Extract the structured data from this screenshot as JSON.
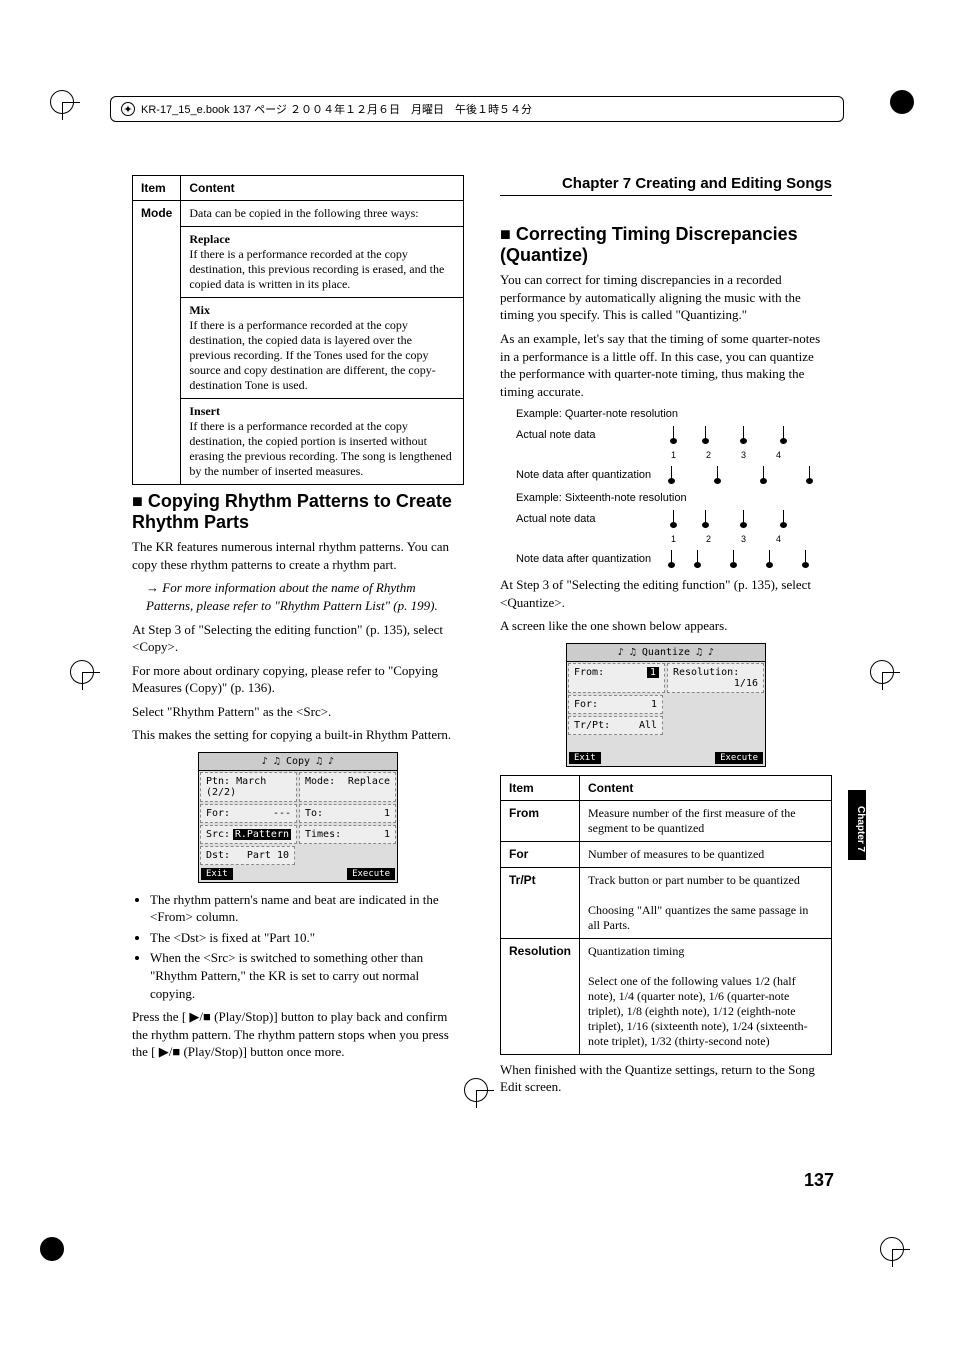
{
  "header": {
    "book_info": "KR-17_15_e.book  137 ページ  ２００４年１２月６日　月曜日　午後１時５４分"
  },
  "chapterTitle": "Chapter 7 Creating and Editing Songs",
  "sideTab": "Chapter 7",
  "pageNumber": "137",
  "left": {
    "table1": {
      "h1": "Item",
      "h2": "Content",
      "modeLabel": "Mode",
      "intro": "Data can be copied in the following three ways:",
      "replace": {
        "title": "Replace",
        "body": "If there is a performance recorded at the copy destination, this previous recording is erased, and the copied data is written in its place."
      },
      "mix": {
        "title": "Mix",
        "body": "If there is a performance recorded at the copy destination, the copied data is layered over the previous recording. If the Tones used for the copy source and copy destination are different, the copy-destination Tone is used."
      },
      "insert": {
        "title": "Insert",
        "body": "If there is a performance recorded at the copy destination, the copied portion is inserted without erasing the previous recording. The song is lengthened by the number of inserted measures."
      }
    },
    "h2": "Copying Rhythm Patterns to Create Rhythm Parts",
    "p1": "The KR features numerous internal rhythm patterns. You can copy these rhythm patterns to create a rhythm part.",
    "note1": "→ For more information about the name of Rhythm Patterns, please refer to \"Rhythm Pattern List\" (p. 199).",
    "p2": "At Step 3 of \"Selecting the editing function\" (p. 135), select <Copy>.",
    "p3": "For more about ordinary copying, please refer to \"Copying Measures (Copy)\" (p. 136).",
    "p4": "Select \"Rhythm Pattern\" as the <Src>.",
    "p5": "This makes the setting for copying a built-in Rhythm Pattern.",
    "screen": {
      "title": "Copy",
      "ptn_l": "Ptn:",
      "ptn_v": "March (2/2)",
      "mode_l": "Mode:",
      "mode_v": "Replace",
      "for_l": "For:",
      "for_v": "---",
      "to_l": "To:",
      "to_v": "1",
      "src_l": "Src:",
      "src_v": "R.Pattern",
      "times_l": "Times:",
      "times_v": "1",
      "dst_l": "Dst:",
      "dst_v": "Part 10",
      "exit": "Exit",
      "exec": "Execute"
    },
    "bul1": "The rhythm pattern's name and beat are indicated in the <From> column.",
    "bul2": "The <Dst> is fixed at \"Part 10.\"",
    "bul3": "When the <Src> is switched to something other than \"Rhythm Pattern,\" the KR is set to carry out normal copying.",
    "p6a": "Press the [ ",
    "p6b": " (Play/Stop)] button to play back and confirm the rhythm pattern. The rhythm pattern stops when you press the [ ",
    "p6c": " (Play/Stop)] button once more.",
    "playIcon": "▶/■"
  },
  "right": {
    "h2": "Correcting Timing Discrepancies (Quantize)",
    "p1": "You can correct for timing discrepancies in a recorded performance by automatically aligning the music with the timing you specify. This is called \"Quantizing.\"",
    "p2": "As an example, let's say that the timing of some quarter-notes in a performance is a little off. In this case, you can quantize the performance with quarter-note timing, thus making the timing accurate.",
    "diag": {
      "ex1": "Example: Quarter-note resolution",
      "lab1": "Actual note data",
      "lab2": "Note data after quantization",
      "ex2": "Example: Sixteenth-note resolution",
      "ticks": [
        "1",
        "2",
        "3",
        "4"
      ]
    },
    "p3": "At Step 3 of \"Selecting the editing function\" (p. 135), select <Quantize>.",
    "p4": "A screen like the one shown below appears.",
    "screen": {
      "title": "Quantize",
      "from_l": "From:",
      "from_v": "1",
      "res_l": "Resolution:",
      "res_v": "1/16",
      "for_l": "For:",
      "for_v": "1",
      "tr_l": "Tr/Pt:",
      "tr_v": "All",
      "exit": "Exit",
      "exec": "Execute"
    },
    "table": {
      "h1": "Item",
      "h2": "Content",
      "from_l": "From",
      "from_c": "Measure number of the first measure of the segment to be quantized",
      "for_l": "For",
      "for_c": "Number of measures to be quantized",
      "tr_l": "Tr/Pt",
      "tr_c1": "Track button or part number to be quantized",
      "tr_c2": "Choosing \"All\" quantizes the same passage in all Parts.",
      "res_l": "Resolution",
      "res_c1": "Quantization timing",
      "res_c2": "Select one of the following values\n1/2 (half note), 1/4 (quarter note), 1/6 (quarter-note triplet), 1/8 (eighth note), 1/12 (eighth-note triplet), 1/16 (sixteenth note), 1/24 (sixteenth-note triplet), 1/32 (thirty-second note)"
    },
    "p5": "When finished with the Quantize settings, return to the Song Edit screen."
  }
}
